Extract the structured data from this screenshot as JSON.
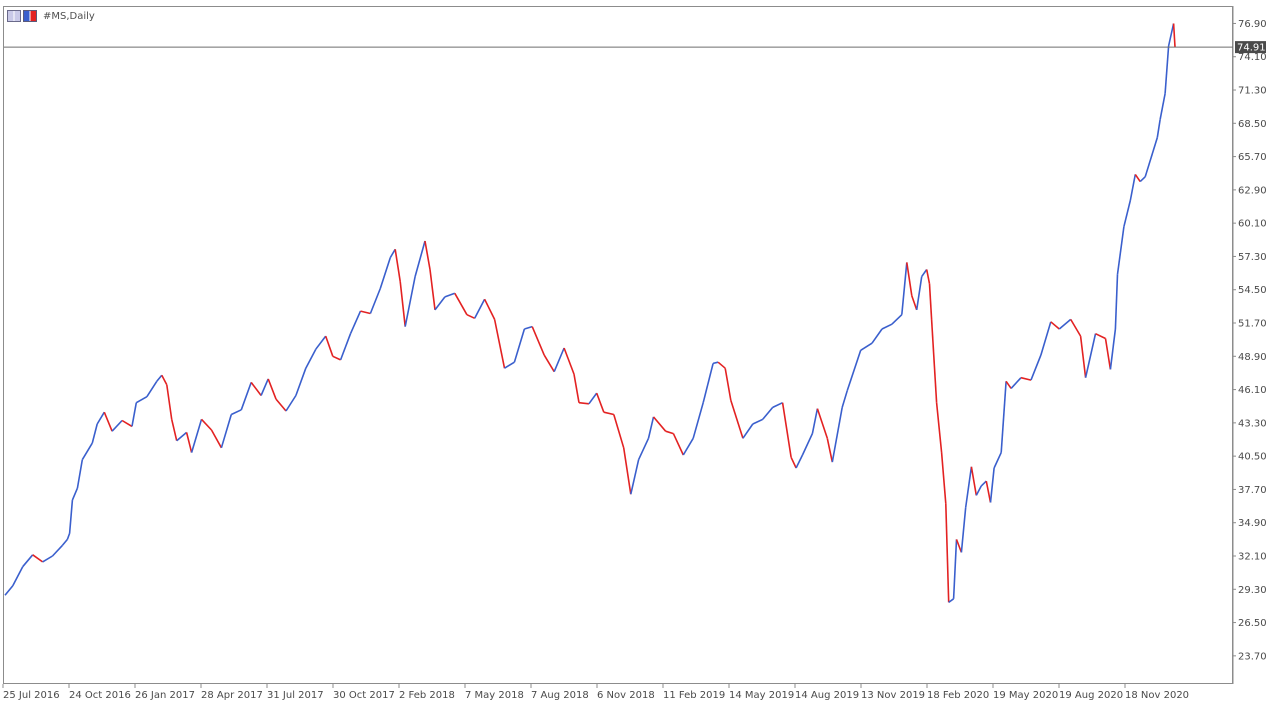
{
  "window": {
    "title": "#MS,Daily"
  },
  "colors": {
    "bull": "#3a5fcd",
    "bear": "#e32222",
    "axis_text": "#4a4a4a",
    "price_line": "#6e6e6e",
    "price_tag_bg": "#4a4a4a"
  },
  "icons": [
    "chart-window-icon",
    "chart-window-maximize-icon"
  ],
  "chart_data": {
    "type": "line",
    "symbol": "#MS",
    "timeframe": "Daily",
    "current_price": "74.91",
    "ylim": [
      21.5,
      78.2
    ],
    "y_ticks": [
      "76.90",
      "74.10",
      "71.30",
      "68.50",
      "65.70",
      "62.90",
      "60.10",
      "57.30",
      "54.50",
      "51.70",
      "48.90",
      "46.10",
      "43.30",
      "40.50",
      "37.70",
      "34.90",
      "32.10",
      "29.30",
      "26.50",
      "23.70"
    ],
    "x_ticks": [
      "25 Jul 2016",
      "24 Oct 2016",
      "26 Jan 2017",
      "28 Apr 2017",
      "31 Jul 2017",
      "30 Oct 2017",
      "2 Feb 2018",
      "7 May 2018",
      "7 Aug 2018",
      "6 Nov 2018",
      "11 Feb 2019",
      "14 May 2019",
      "14 Aug 2019",
      "13 Nov 2019",
      "18 Feb 2020",
      "19 May 2020",
      "19 Aug 2020",
      "18 Nov 2020"
    ],
    "series": [
      {
        "values": [
          {
            "x": "2016-07-25",
            "y": 28.8
          },
          {
            "x": "2016-08-05",
            "y": 29.6
          },
          {
            "x": "2016-08-19",
            "y": 31.2
          },
          {
            "x": "2016-09-02",
            "y": 32.2
          },
          {
            "x": "2016-09-16",
            "y": 31.6
          },
          {
            "x": "2016-09-30",
            "y": 32.1
          },
          {
            "x": "2016-10-14",
            "y": 33.0
          },
          {
            "x": "2016-10-21",
            "y": 33.5
          },
          {
            "x": "2016-10-24",
            "y": 34.0
          },
          {
            "x": "2016-10-28",
            "y": 36.8
          },
          {
            "x": "2016-11-04",
            "y": 37.8
          },
          {
            "x": "2016-11-11",
            "y": 40.2
          },
          {
            "x": "2016-11-25",
            "y": 41.6
          },
          {
            "x": "2016-12-02",
            "y": 43.2
          },
          {
            "x": "2016-12-12",
            "y": 44.2
          },
          {
            "x": "2016-12-23",
            "y": 42.6
          },
          {
            "x": "2017-01-06",
            "y": 43.5
          },
          {
            "x": "2017-01-20",
            "y": 43.0
          },
          {
            "x": "2017-01-26",
            "y": 45.0
          },
          {
            "x": "2017-02-10",
            "y": 45.5
          },
          {
            "x": "2017-02-24",
            "y": 46.8
          },
          {
            "x": "2017-03-03",
            "y": 47.3
          },
          {
            "x": "2017-03-10",
            "y": 46.5
          },
          {
            "x": "2017-03-17",
            "y": 43.6
          },
          {
            "x": "2017-03-24",
            "y": 41.8
          },
          {
            "x": "2017-04-07",
            "y": 42.5
          },
          {
            "x": "2017-04-14",
            "y": 40.8
          },
          {
            "x": "2017-04-28",
            "y": 43.6
          },
          {
            "x": "2017-05-12",
            "y": 42.7
          },
          {
            "x": "2017-05-26",
            "y": 41.2
          },
          {
            "x": "2017-06-09",
            "y": 44.0
          },
          {
            "x": "2017-06-23",
            "y": 44.4
          },
          {
            "x": "2017-07-07",
            "y": 46.7
          },
          {
            "x": "2017-07-21",
            "y": 45.6
          },
          {
            "x": "2017-07-31",
            "y": 47.0
          },
          {
            "x": "2017-08-11",
            "y": 45.3
          },
          {
            "x": "2017-08-25",
            "y": 44.3
          },
          {
            "x": "2017-09-08",
            "y": 45.6
          },
          {
            "x": "2017-09-22",
            "y": 47.9
          },
          {
            "x": "2017-10-06",
            "y": 49.5
          },
          {
            "x": "2017-10-20",
            "y": 50.6
          },
          {
            "x": "2017-10-30",
            "y": 48.9
          },
          {
            "x": "2017-11-10",
            "y": 48.6
          },
          {
            "x": "2017-11-24",
            "y": 50.8
          },
          {
            "x": "2017-12-08",
            "y": 52.7
          },
          {
            "x": "2017-12-22",
            "y": 52.5
          },
          {
            "x": "2018-01-05",
            "y": 54.6
          },
          {
            "x": "2018-01-19",
            "y": 57.2
          },
          {
            "x": "2018-01-26",
            "y": 57.9
          },
          {
            "x": "2018-02-02",
            "y": 55.2
          },
          {
            "x": "2018-02-09",
            "y": 51.4
          },
          {
            "x": "2018-02-23",
            "y": 55.6
          },
          {
            "x": "2018-03-09",
            "y": 58.6
          },
          {
            "x": "2018-03-16",
            "y": 56.2
          },
          {
            "x": "2018-03-23",
            "y": 52.8
          },
          {
            "x": "2018-04-06",
            "y": 53.9
          },
          {
            "x": "2018-04-20",
            "y": 54.2
          },
          {
            "x": "2018-05-07",
            "y": 52.4
          },
          {
            "x": "2018-05-18",
            "y": 52.1
          },
          {
            "x": "2018-06-01",
            "y": 53.7
          },
          {
            "x": "2018-06-15",
            "y": 52.0
          },
          {
            "x": "2018-06-29",
            "y": 47.9
          },
          {
            "x": "2018-07-13",
            "y": 48.4
          },
          {
            "x": "2018-07-27",
            "y": 51.2
          },
          {
            "x": "2018-08-07",
            "y": 51.4
          },
          {
            "x": "2018-08-24",
            "y": 49.0
          },
          {
            "x": "2018-09-07",
            "y": 47.6
          },
          {
            "x": "2018-09-21",
            "y": 49.6
          },
          {
            "x": "2018-10-05",
            "y": 47.4
          },
          {
            "x": "2018-10-12",
            "y": 45.0
          },
          {
            "x": "2018-10-26",
            "y": 44.9
          },
          {
            "x": "2018-11-06",
            "y": 45.8
          },
          {
            "x": "2018-11-16",
            "y": 44.2
          },
          {
            "x": "2018-11-30",
            "y": 44.0
          },
          {
            "x": "2018-12-14",
            "y": 41.2
          },
          {
            "x": "2018-12-24",
            "y": 37.3
          },
          {
            "x": "2019-01-04",
            "y": 40.2
          },
          {
            "x": "2019-01-18",
            "y": 42.0
          },
          {
            "x": "2019-01-25",
            "y": 43.8
          },
          {
            "x": "2019-02-11",
            "y": 42.6
          },
          {
            "x": "2019-02-22",
            "y": 42.4
          },
          {
            "x": "2019-03-08",
            "y": 40.6
          },
          {
            "x": "2019-03-22",
            "y": 42.0
          },
          {
            "x": "2019-04-05",
            "y": 45.0
          },
          {
            "x": "2019-04-19",
            "y": 48.3
          },
          {
            "x": "2019-04-26",
            "y": 48.4
          },
          {
            "x": "2019-05-06",
            "y": 47.9
          },
          {
            "x": "2019-05-14",
            "y": 45.2
          },
          {
            "x": "2019-05-31",
            "y": 42.0
          },
          {
            "x": "2019-06-14",
            "y": 43.2
          },
          {
            "x": "2019-06-28",
            "y": 43.6
          },
          {
            "x": "2019-07-12",
            "y": 44.6
          },
          {
            "x": "2019-07-26",
            "y": 45.0
          },
          {
            "x": "2019-08-07",
            "y": 40.4
          },
          {
            "x": "2019-08-14",
            "y": 39.5
          },
          {
            "x": "2019-08-23",
            "y": 40.6
          },
          {
            "x": "2019-09-06",
            "y": 42.4
          },
          {
            "x": "2019-09-13",
            "y": 44.5
          },
          {
            "x": "2019-09-27",
            "y": 42.0
          },
          {
            "x": "2019-10-04",
            "y": 40.0
          },
          {
            "x": "2019-10-18",
            "y": 44.6
          },
          {
            "x": "2019-10-25",
            "y": 46.0
          },
          {
            "x": "2019-11-13",
            "y": 49.4
          },
          {
            "x": "2019-11-29",
            "y": 50.0
          },
          {
            "x": "2019-12-13",
            "y": 51.2
          },
          {
            "x": "2019-12-27",
            "y": 51.6
          },
          {
            "x": "2020-01-10",
            "y": 52.4
          },
          {
            "x": "2020-01-17",
            "y": 56.8
          },
          {
            "x": "2020-01-24",
            "y": 54.0
          },
          {
            "x": "2020-01-31",
            "y": 52.8
          },
          {
            "x": "2020-02-07",
            "y": 55.6
          },
          {
            "x": "2020-02-14",
            "y": 56.2
          },
          {
            "x": "2020-02-18",
            "y": 55.0
          },
          {
            "x": "2020-02-21",
            "y": 52.0
          },
          {
            "x": "2020-02-28",
            "y": 45.0
          },
          {
            "x": "2020-03-06",
            "y": 40.8
          },
          {
            "x": "2020-03-12",
            "y": 36.5
          },
          {
            "x": "2020-03-16",
            "y": 28.2
          },
          {
            "x": "2020-03-23",
            "y": 28.5
          },
          {
            "x": "2020-03-27",
            "y": 33.5
          },
          {
            "x": "2020-04-03",
            "y": 32.4
          },
          {
            "x": "2020-04-09",
            "y": 36.2
          },
          {
            "x": "2020-04-17",
            "y": 39.6
          },
          {
            "x": "2020-04-24",
            "y": 37.2
          },
          {
            "x": "2020-05-01",
            "y": 38.0
          },
          {
            "x": "2020-05-08",
            "y": 38.4
          },
          {
            "x": "2020-05-14",
            "y": 36.6
          },
          {
            "x": "2020-05-19",
            "y": 39.5
          },
          {
            "x": "2020-05-29",
            "y": 40.8
          },
          {
            "x": "2020-06-05",
            "y": 46.8
          },
          {
            "x": "2020-06-12",
            "y": 46.2
          },
          {
            "x": "2020-06-26",
            "y": 47.1
          },
          {
            "x": "2020-07-10",
            "y": 46.9
          },
          {
            "x": "2020-07-24",
            "y": 49.0
          },
          {
            "x": "2020-08-07",
            "y": 51.8
          },
          {
            "x": "2020-08-19",
            "y": 51.2
          },
          {
            "x": "2020-09-04",
            "y": 52.0
          },
          {
            "x": "2020-09-18",
            "y": 50.6
          },
          {
            "x": "2020-09-25",
            "y": 47.1
          },
          {
            "x": "2020-10-09",
            "y": 50.8
          },
          {
            "x": "2020-10-23",
            "y": 50.4
          },
          {
            "x": "2020-10-30",
            "y": 47.8
          },
          {
            "x": "2020-11-06",
            "y": 51.2
          },
          {
            "x": "2020-11-09",
            "y": 55.8
          },
          {
            "x": "2020-11-18",
            "y": 59.8
          },
          {
            "x": "2020-11-27",
            "y": 62.0
          },
          {
            "x": "2020-12-04",
            "y": 64.2
          },
          {
            "x": "2020-12-11",
            "y": 63.6
          },
          {
            "x": "2020-12-18",
            "y": 64.0
          },
          {
            "x": "2021-01-04",
            "y": 67.3
          },
          {
            "x": "2021-01-08",
            "y": 68.8
          },
          {
            "x": "2021-01-15",
            "y": 71.0
          },
          {
            "x": "2021-01-20",
            "y": 75.0
          },
          {
            "x": "2021-01-27",
            "y": 76.9
          },
          {
            "x": "2021-01-29",
            "y": 74.91
          }
        ]
      }
    ]
  }
}
